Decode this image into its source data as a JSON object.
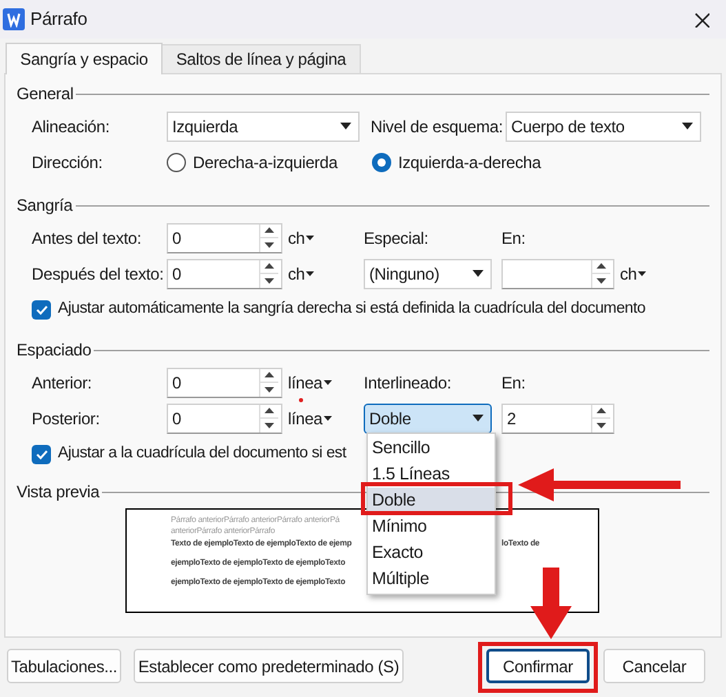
{
  "window": {
    "title": "Párrafo"
  },
  "tabs": [
    {
      "label": "Sangría y espacio",
      "selected": true
    },
    {
      "label": "Saltos de línea y página",
      "selected": false
    }
  ],
  "general": {
    "heading": "General",
    "alignment": {
      "label": "Alineación:",
      "value": "Izquierda"
    },
    "outline_level": {
      "label": "Nivel de esquema:",
      "value": "Cuerpo de texto"
    },
    "direction": {
      "label": "Dirección:",
      "options": [
        {
          "label": "Derecha-a-izquierda",
          "selected": false
        },
        {
          "label": "Izquierda-a-derecha",
          "selected": true
        }
      ]
    }
  },
  "indentation": {
    "heading": "Sangría",
    "before": {
      "label": "Antes del texto:",
      "value": "0",
      "unit": "ch"
    },
    "after": {
      "label": "Después del texto:",
      "value": "0",
      "unit": "ch"
    },
    "special": {
      "label": "Especial:",
      "value": "(Ninguno)"
    },
    "by": {
      "label": "En:",
      "unit": "ch"
    },
    "checkbox": {
      "label": "Ajustar automáticamente la sangría derecha si está definida la cuadrícula del documento",
      "checked": true
    }
  },
  "spacing": {
    "heading": "Espaciado",
    "before": {
      "label": "Anterior:",
      "value": "0",
      "unit": "línea"
    },
    "after": {
      "label": "Posterior:",
      "value": "0",
      "unit": "línea"
    },
    "line_spacing": {
      "label": "Interlineado:",
      "value": "Doble"
    },
    "at": {
      "label": "En:",
      "value": "2"
    },
    "checkbox": {
      "label": "Ajustar a la cuadrícula del documento si est",
      "checked": true
    },
    "dropdown_options": [
      {
        "label": "Sencillo",
        "selected": false
      },
      {
        "label": "1.5 Líneas",
        "selected": false
      },
      {
        "label": "Doble",
        "selected": true
      },
      {
        "label": "Mínimo",
        "selected": false
      },
      {
        "label": "Exacto",
        "selected": false
      },
      {
        "label": "Múltiple",
        "selected": false
      }
    ]
  },
  "preview": {
    "heading": "Vista previa",
    "lines": [
      {
        "kind": "previous",
        "left": "Párrafo anteriorPárrafo anteriorPárrafo anteriorPá"
      },
      {
        "kind": "previous",
        "left": "anteriorPárrafo anteriorPárrafo"
      },
      {
        "kind": "sample",
        "left": "Texto de ejemploTexto de ejemploTexto de ejemp",
        "right": "loTexto de"
      },
      {
        "kind": "sample",
        "left": "ejemploTexto de ejemploTexto de ejemploTexto"
      },
      {
        "kind": "sample",
        "left": "ejemploTexto de ejemploTexto de ejemploTexto"
      }
    ]
  },
  "buttons": [
    {
      "label": "Tabulaciones...",
      "focused": false
    },
    {
      "label": "Establecer como predeterminado (S)",
      "focused": false
    },
    {
      "label": "Confirmar",
      "focused": true
    },
    {
      "label": "Cancelar",
      "focused": false
    }
  ]
}
